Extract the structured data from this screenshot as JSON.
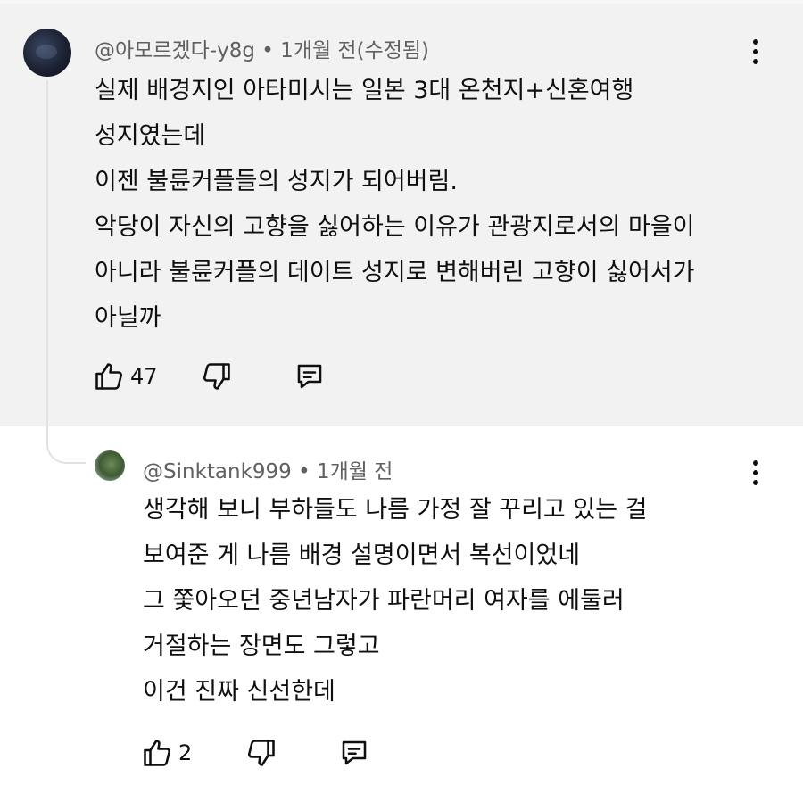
{
  "comment": {
    "author": "@아모르겠다-y8g",
    "separator": "•",
    "time": "1개월 전(수정됨)",
    "lines": [
      "실제 배경지인 아타미시는 일본 3대 온천지+신혼여행",
      "성지였는데",
      "이젠 불륜커플들의 성지가 되어버림.",
      "악당이 자신의 고향을 싫어하는 이유가 관광지로서의 마을이",
      "아니라 불륜커플의 데이트 성지로 변해버린 고향이 싫어서가",
      "아닐까"
    ],
    "like_count": "47",
    "icons": {
      "like": "thumbs-up-icon",
      "dislike": "thumbs-down-icon",
      "reply": "reply-icon",
      "menu": "more-vert-icon"
    }
  },
  "reply": {
    "author": "@Sinktank999",
    "separator": "•",
    "time": "1개월 전",
    "lines": [
      "생각해 보니 부하들도 나름 가정 잘 꾸리고 있는 걸",
      "보여준 게 나름 배경 설명이면서 복선이었네",
      "그 쫓아오던 중년남자가 파란머리 여자를 에둘러",
      "거절하는 장면도 그렇고",
      "이건 진짜 신선한데"
    ],
    "like_count": "2"
  },
  "colors": {
    "highlight_bg": "#f2f2f2",
    "meta_text": "#606060",
    "text": "#0f0f0f"
  }
}
